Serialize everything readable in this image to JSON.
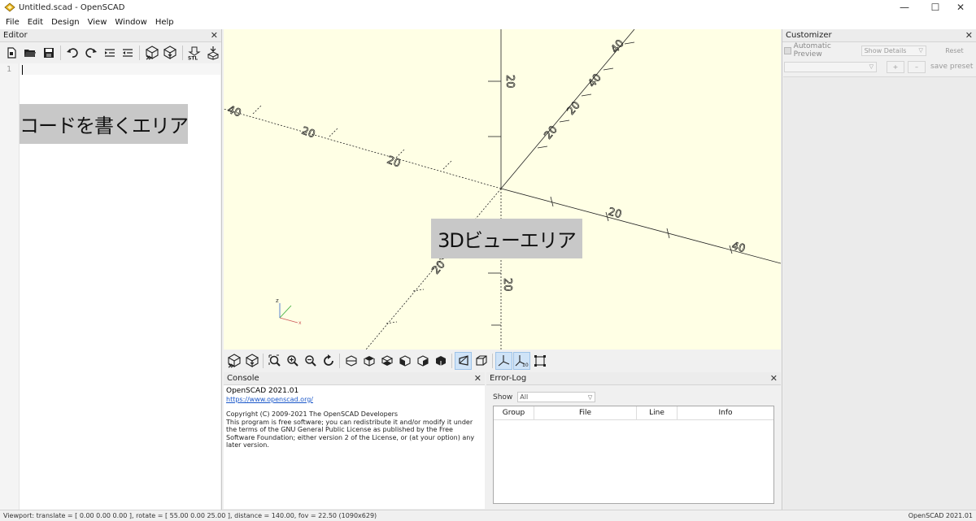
{
  "window": {
    "title": "Untitled.scad - OpenSCAD",
    "minimize": "—",
    "maximize": "☐",
    "close": "✕"
  },
  "menu": [
    "File",
    "Edit",
    "Design",
    "View",
    "Window",
    "Help"
  ],
  "editor": {
    "title": "Editor",
    "close": "✕",
    "line_number": "1",
    "annotation": "コードを書くエリア"
  },
  "viewport": {
    "annotation": "3Dビューエリア",
    "axis_ticks": [
      "20",
      "40",
      "20",
      "40",
      "20",
      "40",
      "20",
      "20",
      "20",
      "20",
      "20",
      "40"
    ],
    "background_color": "#ffffe5"
  },
  "console": {
    "title": "Console",
    "close": "✕",
    "version": "OpenSCAD 2021.01",
    "link": "https://www.openscad.org/",
    "copyright": "Copyright (C) 2009-2021 The OpenSCAD Developers",
    "license_lines": [
      "This program is free software; you can redistribute it and/or modify it under",
      "the terms of the GNU General Public License as published by the Free",
      "Software Foundation; either version 2 of the License, or (at your option) any",
      "later version."
    ]
  },
  "errorlog": {
    "title": "Error-Log",
    "close": "✕",
    "show_label": "Show",
    "show_value": "All",
    "columns": [
      "Group",
      "File",
      "Line",
      "Info"
    ]
  },
  "customizer": {
    "title": "Customizer",
    "close": "✕",
    "automatic_preview": "Automatic Preview",
    "show_details": "Show Details",
    "reset": "Reset",
    "add": "+",
    "remove": "–",
    "save_preset": "save preset"
  },
  "statusbar": {
    "left": "Viewport: translate = [ 0.00 0.00 0.00 ], rotate = [ 55.00 0.00 25.00 ], distance = 140.00, fov = 22.50 (1090x629)",
    "right": "OpenSCAD 2021.01"
  }
}
